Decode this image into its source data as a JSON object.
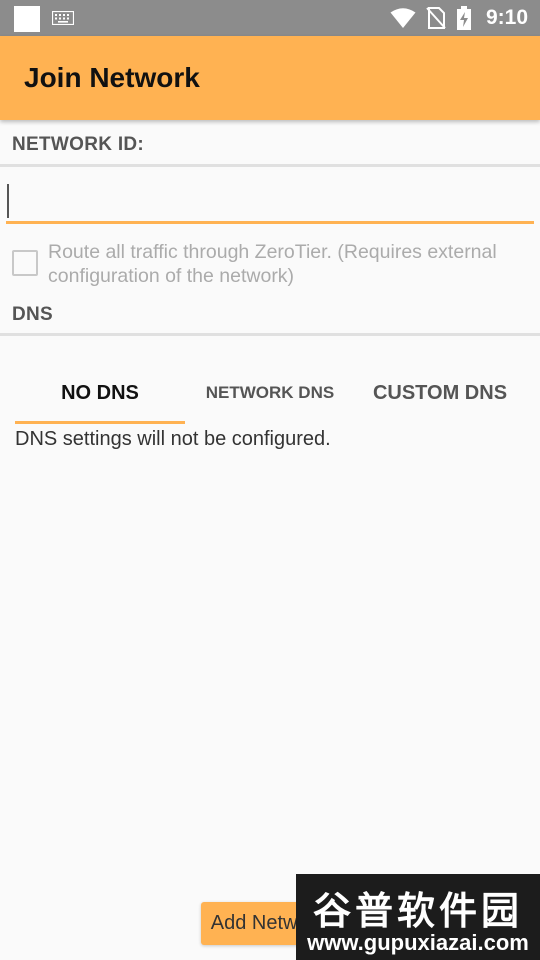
{
  "status_bar": {
    "time": "9:10",
    "icons": [
      "app-notification-icon",
      "keyboard-icon",
      "wifi-icon",
      "no-sim-icon",
      "battery-charging-icon"
    ]
  },
  "app_bar": {
    "title": "Join Network"
  },
  "form": {
    "network_id_label": "NETWORK ID:",
    "network_id_value": "",
    "route_all_label": "Route all traffic through ZeroTier. (Requires external configuration of the network)",
    "route_all_checked": false,
    "dns_label": "DNS"
  },
  "dns_tabs": [
    {
      "label": "NO DNS",
      "selected": true
    },
    {
      "label": "NETWORK DNS",
      "selected": false
    },
    {
      "label": "CUSTOM DNS",
      "selected": false
    }
  ],
  "dns_description": "DNS settings will not be configured.",
  "add_button_label": "Add Network",
  "watermark": {
    "brand": "谷普软件园",
    "url": "www.gupuxiazai.com"
  },
  "colors": {
    "accent": "#ffb252",
    "status_bar": "#8c8c8c",
    "background": "#fafafa",
    "disabled_text": "#ababab"
  }
}
